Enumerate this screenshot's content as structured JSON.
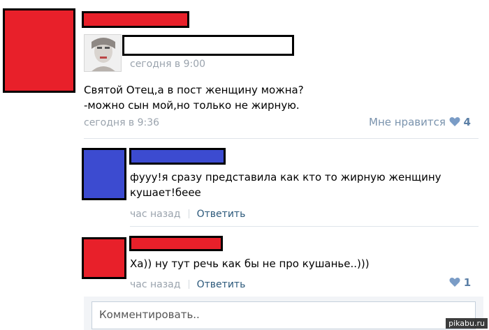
{
  "post": {
    "author_meta": "сегодня в 9:00",
    "text_line1": "Святой Отец,а в пост женщину можна?",
    "text_line2": "-можно сын мой,но только не жирную.",
    "timestamp": "сегодня в 9:36",
    "like_label": "Мне нравится",
    "like_count": "4",
    "like_icon": "heart-icon"
  },
  "comments": [
    {
      "text_line1": "фууу!я сразу представила как кто то жирную женщину",
      "text_line2": "кушает!беее",
      "time": "час назад",
      "reply_label": "Ответить",
      "avatar_color": "#3c4bd0"
    },
    {
      "text_line1": "Ха)) ну тут речь как бы не про кушанье..)))",
      "time": "час назад",
      "reply_label": "Ответить",
      "like_count": "1",
      "like_icon": "heart-icon",
      "avatar_color": "#e8202a"
    }
  ],
  "comment_input": {
    "placeholder": "Комментировать.."
  },
  "watermark": "pikabu.ru",
  "colors": {
    "redaction_red": "#e8202a",
    "redaction_blue": "#3c4bd0",
    "link": "#2b587a",
    "meta": "#9aa3ad"
  }
}
